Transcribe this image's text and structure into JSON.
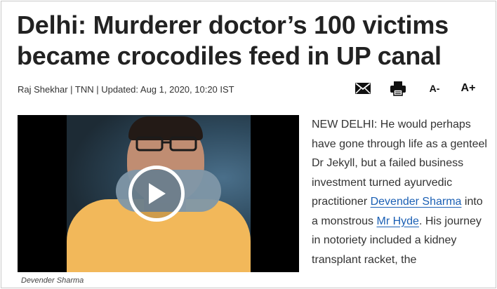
{
  "headline": "Delhi: Murderer doctor’s 100 victims became crocodiles feed in UP canal",
  "byline": {
    "author": "Raj Shekhar",
    "sep1": " | ",
    "source": "TNN",
    "sep2": " | ",
    "updated": "Updated: Aug 1, 2020, 10:20 IST"
  },
  "tools": {
    "mail_icon": "mail-icon",
    "print_icon": "print-icon",
    "decrease_font": "A-",
    "increase_font": "A+"
  },
  "video": {
    "caption": "Devender Sharma",
    "play_icon": "play-icon"
  },
  "article": {
    "p1": "NEW DELHI: He would perhaps have gone through life as a genteel Dr Jekyll, but a failed business investment turned ayurvedic practitioner ",
    "link1": "Devender Sharma",
    "p2": " into a monstrous ",
    "link2": "Mr Hyde",
    "p3": ". His journey in notoriety included a kidney transplant racket, the"
  }
}
